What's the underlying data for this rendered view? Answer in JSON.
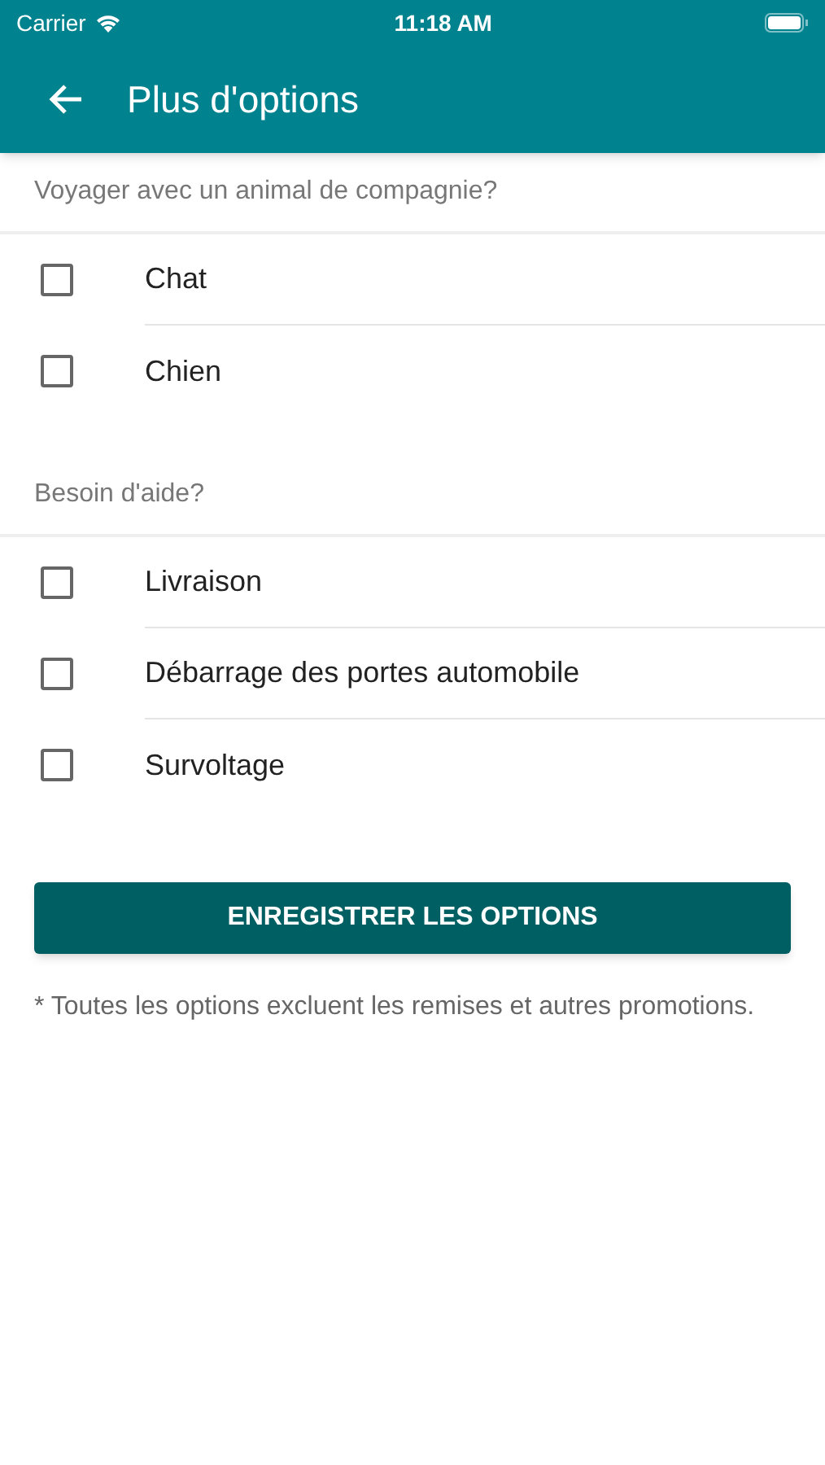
{
  "status_bar": {
    "carrier": "Carrier",
    "time": "11:18 AM"
  },
  "header": {
    "title": "Plus d'options"
  },
  "sections": [
    {
      "heading": "Voyager avec un animal de compagnie?",
      "options": [
        {
          "label": "Chat",
          "checked": false
        },
        {
          "label": "Chien",
          "checked": false
        }
      ]
    },
    {
      "heading": "Besoin d'aide?",
      "options": [
        {
          "label": "Livraison",
          "checked": false
        },
        {
          "label": "Débarrage des portes automobile",
          "checked": false
        },
        {
          "label": "Survoltage",
          "checked": false
        }
      ]
    }
  ],
  "save_button": "ENREGISTRER LES OPTIONS",
  "footnote": "* Toutes les options excluent les remises et autres promotions."
}
